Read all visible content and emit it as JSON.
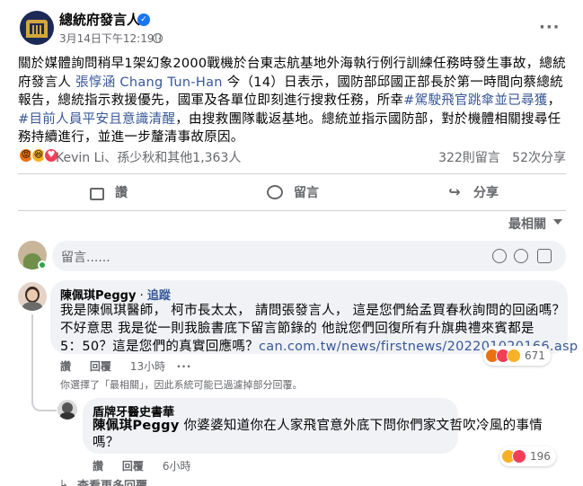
{
  "post": {
    "page_name": "總統府發言人",
    "timestamp": "3月14日下午12:19",
    "separator": " · ",
    "text_before_name": "關於媒體詢問稍早1架幻象2000戰機於台東志航基地外海執行例行訓練任務時發生事故，總統府發言人 ",
    "spokesperson_link": "張惇涵 Chang Tun-Han",
    "text_mid": " 今（14）日表示，國防部邱國正部長於第一時間向蔡總統報告，總統指示救援優先，國軍及各單位即刻進行搜救任務，所幸",
    "hashtag_1": "#駕駛飛官跳傘並已尋獲",
    "hashtag_sep": "，",
    "hashtag_2": "#目前人員平安且意識清醒",
    "text_after": "，由搜救團隊載返基地。總統並指示國防部，對於機體相關搜尋任務持續進行，並進一步釐清事故原因。"
  },
  "reactions": {
    "names": "Kevin Li、孫少秋和其他1,363人",
    "comments_count": "322則留言",
    "shares_count": "52次分享"
  },
  "actions": {
    "like": "讚",
    "comment": "留言",
    "share": "分享"
  },
  "sort": {
    "label": "最相關"
  },
  "composer": {
    "placeholder": "留言......"
  },
  "comments": [
    {
      "author": "陳佩琪Peggy",
      "dot": " · ",
      "follow": "追蹤",
      "line1": "我是陳佩琪醫師， 柯市長太太， 請問張發言人， 這是您們給孟買春秋詢問的回函嗎？",
      "line2": "不好意思 我是從一則我臉書底下留言節錄的 他說您們回復所有升旗典禮來賓都是",
      "line3_prefix": "5：50？這是您們的真實回應嗎？",
      "link": "can.com.tw/news/firstnews/202201020166.asp",
      "like": "讚",
      "reply": "回覆",
      "time": "13小時",
      "reaction_count": "671"
    },
    {
      "author": "盾牌牙醫史書華",
      "mention": "陳佩琪Peggy",
      "text_1": " 你婆婆知道你在人家飛官意外底下問你們家文哲吹冷風的事情",
      "text_2": "嗎？",
      "like": "讚",
      "reply": "回覆",
      "time": "6小時",
      "reaction_count": "196"
    }
  ],
  "filter_note": "你選擇了「最相關」，因此系統可能已過濾掉部分回覆。",
  "more_replies": "查看更多回覆",
  "colors": {
    "link_blue": "#385898",
    "meta_grey": "#65676b",
    "bubble_bg": "#f0f2f5",
    "verified_blue": "#1877f2"
  }
}
